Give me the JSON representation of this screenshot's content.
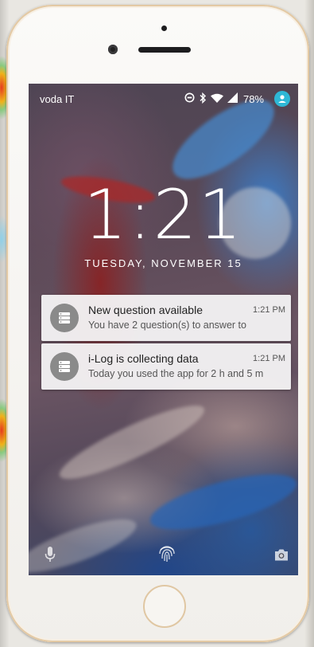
{
  "status_bar": {
    "carrier": "voda IT",
    "battery": "78%",
    "icons": [
      "data-saver-icon",
      "bluetooth-icon",
      "wifi-icon",
      "cell-signal-icon",
      "account-icon"
    ]
  },
  "lock_screen": {
    "time": "1:21",
    "date": "TUESDAY, NOVEMBER 15"
  },
  "notifications": [
    {
      "icon": "database-icon",
      "title": "New question available",
      "time": "1:21 PM",
      "text": "You have 2 question(s) to answer to"
    },
    {
      "icon": "database-icon",
      "title": "i-Log is collecting data",
      "time": "1:21 PM",
      "text": "Today you used the app for 2 h and 5 m"
    }
  ],
  "bottom_shortcuts": {
    "left": "microphone-icon",
    "center": "fingerprint-icon",
    "right": "camera-icon"
  },
  "colors": {
    "accent_avatar": "#2eb8d6",
    "notification_bg": "#f4f3f4",
    "phone_trim": "#e0c7a3"
  }
}
